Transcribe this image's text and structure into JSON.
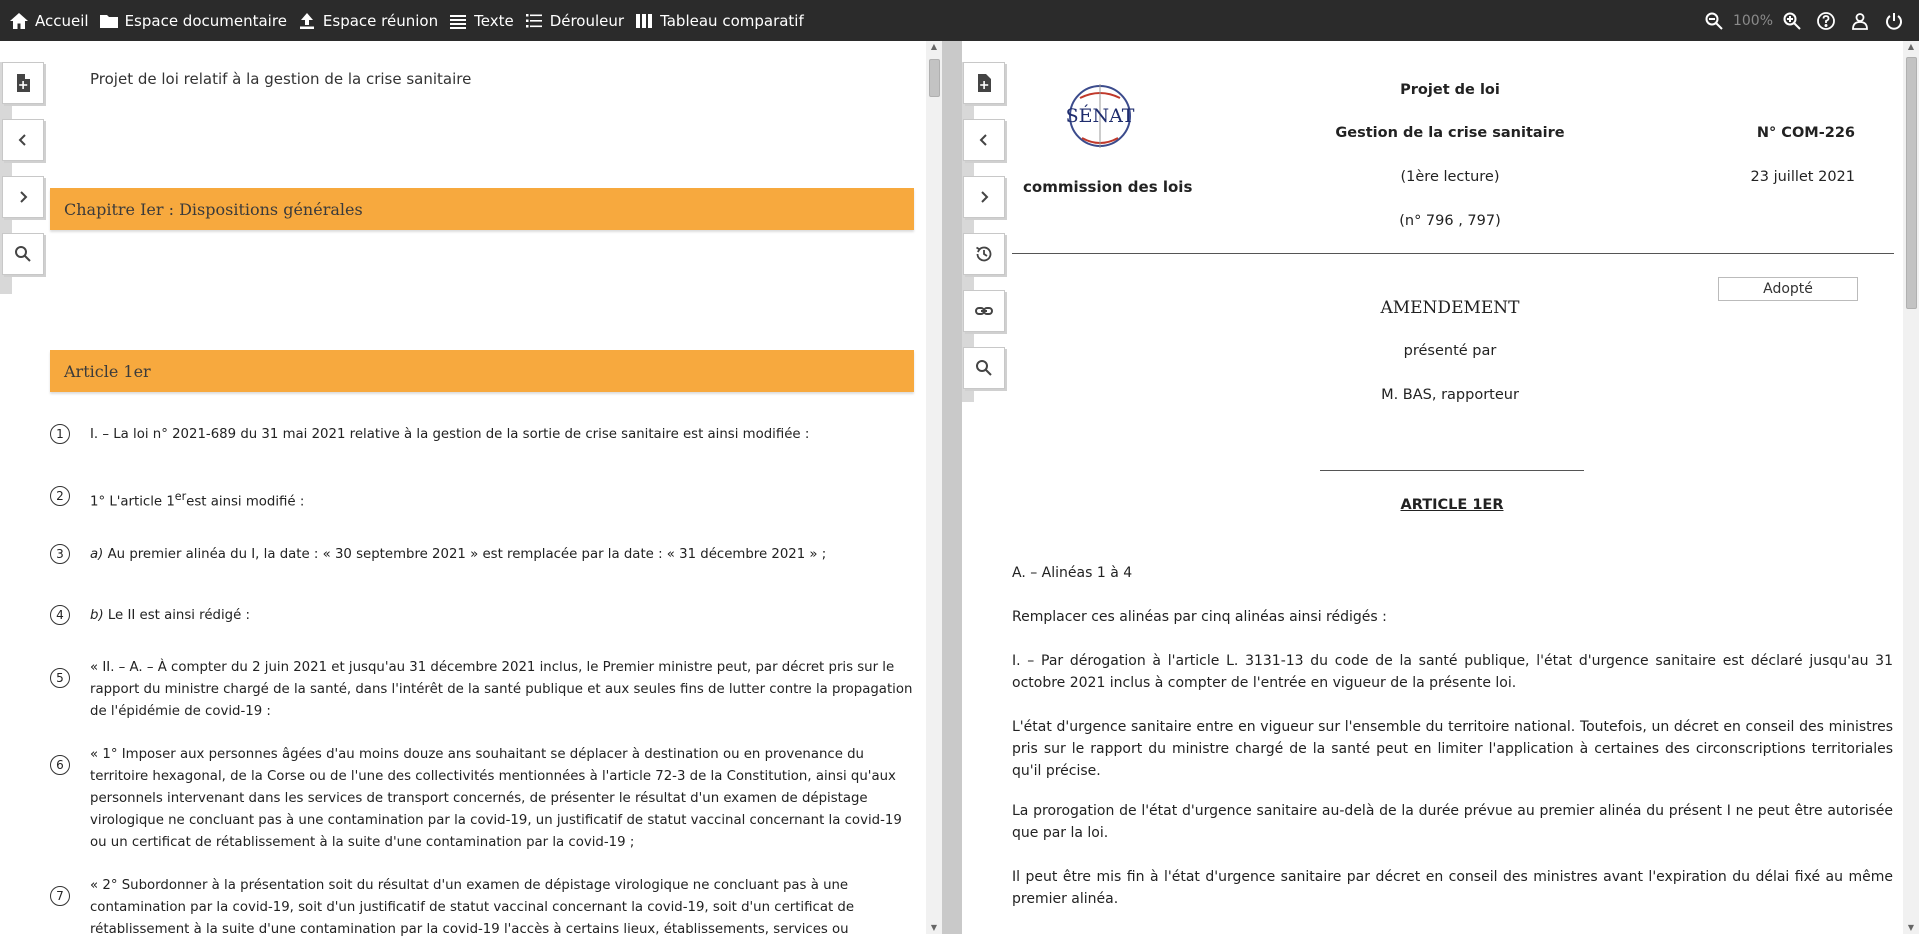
{
  "topbar": {
    "nav": [
      {
        "label": "Accueil",
        "icon": "home-icon"
      },
      {
        "label": "Espace documentaire",
        "icon": "folder-icon"
      },
      {
        "label": "Espace réunion",
        "icon": "upload-icon"
      },
      {
        "label": "Texte",
        "icon": "text-lines-icon"
      },
      {
        "label": "Dérouleur",
        "icon": "list-icon"
      },
      {
        "label": "Tableau comparatif",
        "icon": "columns-icon"
      }
    ],
    "zoom": "100%"
  },
  "left": {
    "doc_title": "Projet de loi relatif à la gestion de la crise sanitaire",
    "chapter": "Chapitre Ier : Dispositions générales",
    "article": "Article 1er",
    "alineas": [
      {
        "num": "1",
        "text": "I. – La loi n° 2021-689 du 31 mai 2021 relative à la gestion de la sortie de crise sanitaire est ainsi modifiée :"
      },
      {
        "num": "2",
        "text_a": "1° L'article 1",
        "sup": "er",
        "text_b": "est ainsi modifié :"
      },
      {
        "num": "3",
        "lead": "a)",
        "text": " Au premier alinéa du I, la date : « 30 septembre 2021 » est remplacée par la date : « 31 décembre 2021 » ;"
      },
      {
        "num": "4",
        "lead": "b)",
        "text": " Le II est ainsi rédigé :"
      },
      {
        "num": "5",
        "text": "« II. – A. – À compter du 2 juin 2021 et jusqu'au 31 décembre 2021 inclus, le Premier ministre peut, par décret pris sur le rapport du ministre chargé de la santé, dans l'intérêt de la santé publique et aux seules fins de lutter contre la propagation de l'épidémie de covid-19 :"
      },
      {
        "num": "6",
        "text": "« 1° Imposer aux personnes âgées d'au moins douze ans souhaitant se déplacer à destination ou en provenance du territoire hexagonal, de la Corse ou de l'une des collectivités mentionnées à l'article 72-3 de la Constitution, ainsi qu'aux personnels intervenant dans les services de transport concernés, de présenter le résultat d'un examen de dépistage virologique ne concluant pas à une contamination par la covid-19, un justificatif de statut vaccinal concernant la covid-19 ou un certificat de rétablissement à la suite d'une contamination par la covid-19 ;"
      },
      {
        "num": "7",
        "text": "« 2° Subordonner à la présentation soit du résultat d'un examen de dépistage virologique ne concluant pas à une contamination par la covid-19, soit d'un justificatif de statut vaccinal concernant la covid-19, soit d'un certificat de rétablissement à la suite d'une contamination par la covid-19 l'accès à certains lieux, établissements, services ou"
      }
    ]
  },
  "right": {
    "logo_text": "SÉNAT",
    "commission": "commission des lois",
    "doc_type": "Projet de loi",
    "subject": "Gestion de la crise sanitaire",
    "reading": "(1ère lecture)",
    "numbers": "(n° 796 , 797)",
    "amend_no": "N° COM-226",
    "date": "23 juillet 2021",
    "status": "Adopté",
    "amendement": "AMENDEMENT",
    "presented_by": "présenté par",
    "author": "M. BAS, rapporteur",
    "article_title": "ARTICLE 1ER",
    "paragraphs": [
      "A. – Alinéas 1 à 4",
      "Remplacer ces alinéas par cinq alinéas ainsi rédigés :",
      "I. – Par dérogation à l'article L. 3131-13 du code de la santé publique, l'état d'urgence sanitaire est déclaré jusqu'au 31 octobre 2021 inclus à compter de l'entrée en vigueur de la présente loi.",
      "L'état d'urgence sanitaire entre en vigueur sur l'ensemble du territoire national. Toutefois, un décret en conseil des ministres pris sur le rapport du ministre chargé de la santé peut en limiter l'application à certaines des circonscriptions territoriales qu'il précise.",
      "La prorogation de l'état d'urgence sanitaire au-delà de la durée prévue au premier alinéa du présent I ne peut être autorisée que par la loi.",
      "Il peut être mis fin à l'état d'urgence sanitaire par décret en conseil des ministres avant l'expiration du délai fixé au même premier alinéa."
    ]
  }
}
